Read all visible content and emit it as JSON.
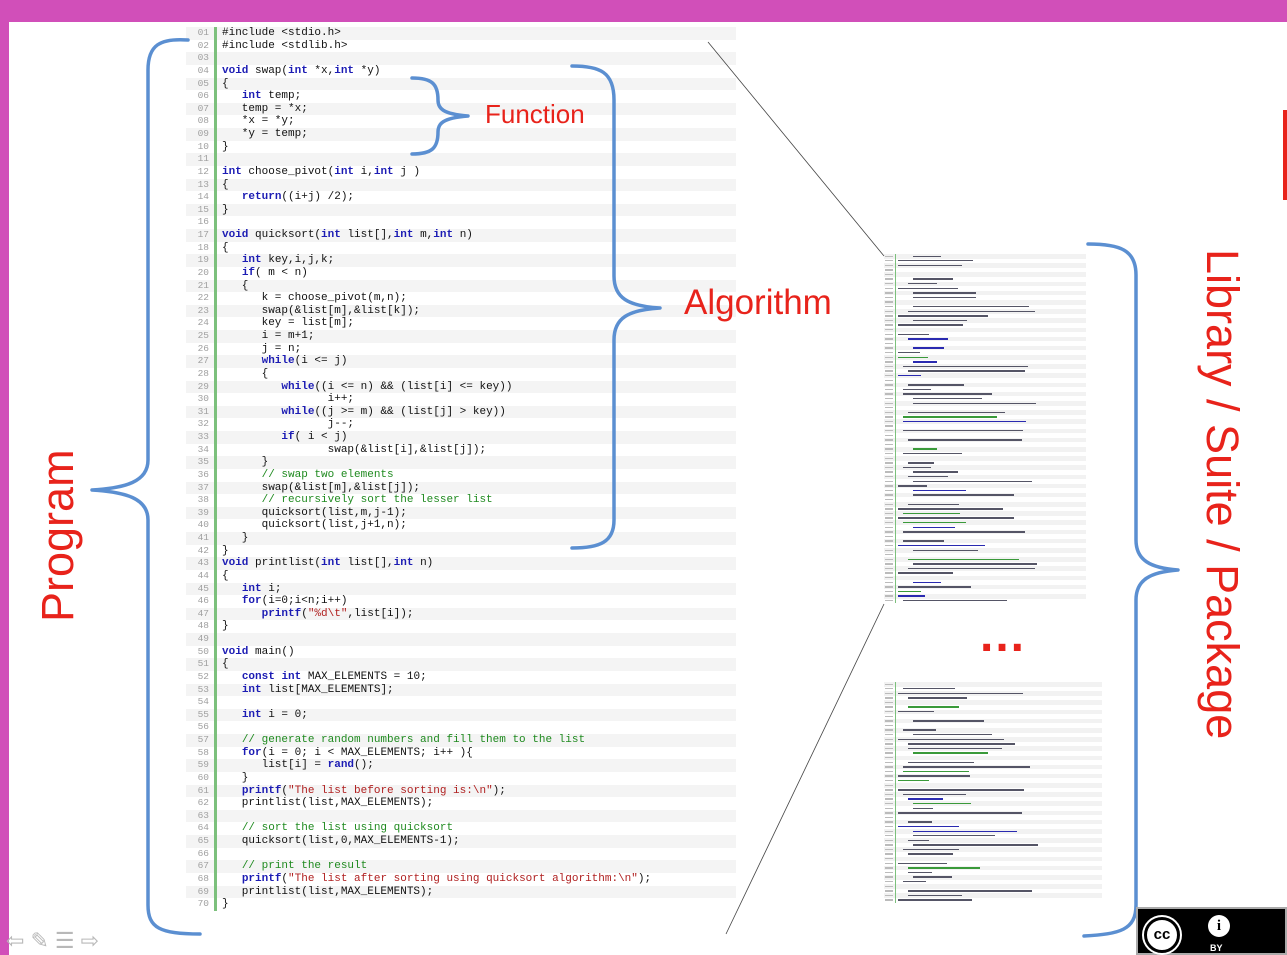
{
  "labels": {
    "function": "Function",
    "algorithm": "Algorithm",
    "program": "Program",
    "library": "Library / Suite / Package",
    "ellipsis": "..."
  },
  "badge": {
    "cc": "cc",
    "by_icon": "i",
    "by": "BY"
  },
  "colors": {
    "frame": "#d14fb9",
    "label_red": "#e8231b",
    "bracket_blue": "#5b8fd1",
    "keyword": "#1c1cb4",
    "comment": "#1f8a1f",
    "string": "#b02020"
  },
  "code": {
    "lines": [
      {
        "n": "01",
        "t": "#include <stdio.h>"
      },
      {
        "n": "02",
        "t": "#include <stdlib.h>"
      },
      {
        "n": "03",
        "t": ""
      },
      {
        "n": "04",
        "t": "void swap(int *x,int *y)"
      },
      {
        "n": "05",
        "t": "{"
      },
      {
        "n": "06",
        "t": "   int temp;"
      },
      {
        "n": "07",
        "t": "   temp = *x;"
      },
      {
        "n": "08",
        "t": "   *x = *y;"
      },
      {
        "n": "09",
        "t": "   *y = temp;"
      },
      {
        "n": "10",
        "t": "}"
      },
      {
        "n": "11",
        "t": ""
      },
      {
        "n": "12",
        "t": "int choose_pivot(int i,int j )"
      },
      {
        "n": "13",
        "t": "{"
      },
      {
        "n": "14",
        "t": "   return((i+j) /2);"
      },
      {
        "n": "15",
        "t": "}"
      },
      {
        "n": "16",
        "t": ""
      },
      {
        "n": "17",
        "t": "void quicksort(int list[],int m,int n)"
      },
      {
        "n": "18",
        "t": "{"
      },
      {
        "n": "19",
        "t": "   int key,i,j,k;"
      },
      {
        "n": "20",
        "t": "   if( m < n)"
      },
      {
        "n": "21",
        "t": "   {"
      },
      {
        "n": "22",
        "t": "      k = choose_pivot(m,n);"
      },
      {
        "n": "23",
        "t": "      swap(&list[m],&list[k]);"
      },
      {
        "n": "24",
        "t": "      key = list[m];"
      },
      {
        "n": "25",
        "t": "      i = m+1;"
      },
      {
        "n": "26",
        "t": "      j = n;"
      },
      {
        "n": "27",
        "t": "      while(i <= j)"
      },
      {
        "n": "28",
        "t": "      {"
      },
      {
        "n": "29",
        "t": "         while((i <= n) && (list[i] <= key))"
      },
      {
        "n": "30",
        "t": "                i++;"
      },
      {
        "n": "31",
        "t": "         while((j >= m) && (list[j] > key))"
      },
      {
        "n": "32",
        "t": "                j--;"
      },
      {
        "n": "33",
        "t": "         if( i < j)"
      },
      {
        "n": "34",
        "t": "                swap(&list[i],&list[j]);"
      },
      {
        "n": "35",
        "t": "      }"
      },
      {
        "n": "36",
        "t": "      // swap two elements"
      },
      {
        "n": "37",
        "t": "      swap(&list[m],&list[j]);"
      },
      {
        "n": "38",
        "t": "      // recursively sort the lesser list"
      },
      {
        "n": "39",
        "t": "      quicksort(list,m,j-1);"
      },
      {
        "n": "40",
        "t": "      quicksort(list,j+1,n);"
      },
      {
        "n": "41",
        "t": "   }"
      },
      {
        "n": "42",
        "t": "}"
      },
      {
        "n": "43",
        "t": "void printlist(int list[],int n)"
      },
      {
        "n": "44",
        "t": "{"
      },
      {
        "n": "45",
        "t": "   int i;"
      },
      {
        "n": "46",
        "t": "   for(i=0;i<n;i++)"
      },
      {
        "n": "47",
        "t": "      printf(\"%d\\t\",list[i]);"
      },
      {
        "n": "48",
        "t": "}"
      },
      {
        "n": "49",
        "t": ""
      },
      {
        "n": "50",
        "t": "void main()"
      },
      {
        "n": "51",
        "t": "{"
      },
      {
        "n": "52",
        "t": "   const int MAX_ELEMENTS = 10;"
      },
      {
        "n": "53",
        "t": "   int list[MAX_ELEMENTS];"
      },
      {
        "n": "54",
        "t": ""
      },
      {
        "n": "55",
        "t": "   int i = 0;"
      },
      {
        "n": "56",
        "t": ""
      },
      {
        "n": "57",
        "t": "   // generate random numbers and fill them to the list"
      },
      {
        "n": "58",
        "t": "   for(i = 0; i < MAX_ELEMENTS; i++ ){"
      },
      {
        "n": "59",
        "t": "      list[i] = rand();"
      },
      {
        "n": "60",
        "t": "   }"
      },
      {
        "n": "61",
        "t": "   printf(\"The list before sorting is:\\n\");"
      },
      {
        "n": "62",
        "t": "   printlist(list,MAX_ELEMENTS);"
      },
      {
        "n": "63",
        "t": ""
      },
      {
        "n": "64",
        "t": "   // sort the list using quicksort"
      },
      {
        "n": "65",
        "t": "   quicksort(list,0,MAX_ELEMENTS-1);"
      },
      {
        "n": "66",
        "t": ""
      },
      {
        "n": "67",
        "t": "   // print the result"
      },
      {
        "n": "68",
        "t": "   printf(\"The list after sorting using quicksort algorithm:\\n\");"
      },
      {
        "n": "69",
        "t": "   printlist(list,MAX_ELEMENTS);"
      },
      {
        "n": "70",
        "t": "}"
      }
    ]
  },
  "nav": {
    "back_icon": "⇦",
    "pen_icon": "✎",
    "menu_icon": "☰",
    "forward_icon": "⇨"
  }
}
